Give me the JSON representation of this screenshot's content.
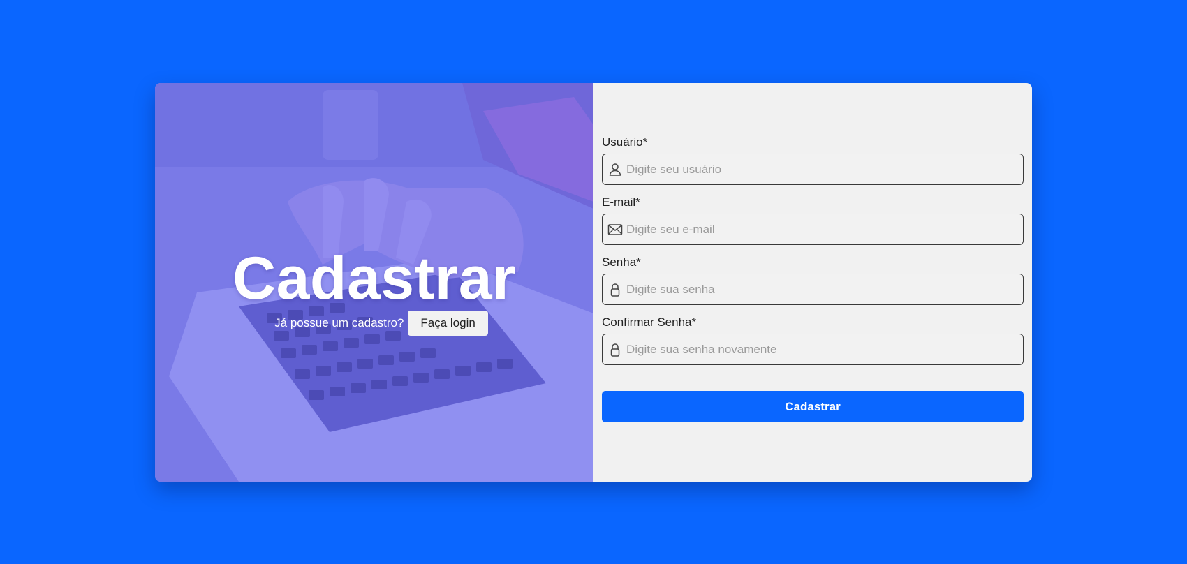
{
  "hero": {
    "title": "Cadastrar",
    "question": "Já possue um cadastro?",
    "login_button": "Faça login"
  },
  "form": {
    "fields": [
      {
        "label": "Usuário*",
        "placeholder": "Digite seu usuário",
        "icon": "user-icon"
      },
      {
        "label": "E-mail*",
        "placeholder": "Digite seu e-mail",
        "icon": "mail-icon"
      },
      {
        "label": "Senha*",
        "placeholder": "Digite sua senha",
        "icon": "lock-icon"
      },
      {
        "label": "Confirmar Senha*",
        "placeholder": "Digite sua senha novamente",
        "icon": "lock-icon"
      }
    ],
    "submit_label": "Cadastrar"
  },
  "colors": {
    "background": "#0a66ff",
    "primary_button": "#0a66ff",
    "panel": "#f1f1f1",
    "hero_tint": "#605ef0"
  }
}
